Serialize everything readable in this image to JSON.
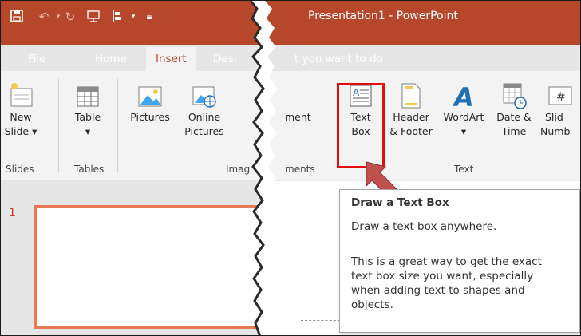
{
  "app": {
    "title": "Presentation1 - PowerPoint"
  },
  "quick_access": [
    {
      "icon": "save-icon"
    },
    {
      "icon": "undo-icon"
    },
    {
      "icon": "redo-icon"
    },
    {
      "icon": "start-from-beginning-icon"
    },
    {
      "icon": "customize-qat-icon"
    }
  ],
  "tabs": {
    "file": "File",
    "home": "Home",
    "insert": "Insert",
    "design": "Desi",
    "tell_me": "t you want to do"
  },
  "ribbon": {
    "new_slide": {
      "line1": "New",
      "line2": "Slide ▾"
    },
    "table": {
      "line1": "Table",
      "line2": "▾"
    },
    "pictures": {
      "line1": "Pictures",
      "line2": ""
    },
    "online_pictures": {
      "line1": "Online",
      "line2": "Pictures"
    },
    "comment": {
      "line1": "ment",
      "line2": ""
    },
    "text_box": {
      "line1": "Text",
      "line2": "Box"
    },
    "header_footer": {
      "line1": "Header",
      "line2": "& Footer"
    },
    "wordart": {
      "line1": "WordArt",
      "line2": "▾"
    },
    "date_time": {
      "line1": "Date &",
      "line2": "Time"
    },
    "slide_number": {
      "line1": "Slid",
      "line2": "Numb"
    },
    "groups": {
      "slides": "Slides",
      "tables": "Tables",
      "images": "Imag",
      "comments": "ments",
      "text": "Text"
    }
  },
  "slide_panel": {
    "slide_number": "1"
  },
  "tooltip": {
    "title": "Draw a Text Box",
    "line1": "Draw a text box anywhere.",
    "body_lines": [
      "This is a great way to get the exact",
      "text box size you want, especially",
      "when adding text to shapes and",
      "objects."
    ]
  },
  "colors": {
    "accent": "#b7472a",
    "highlight": "#e10e0e",
    "arrow": "#c0504d",
    "slide_border": "#e97953"
  }
}
